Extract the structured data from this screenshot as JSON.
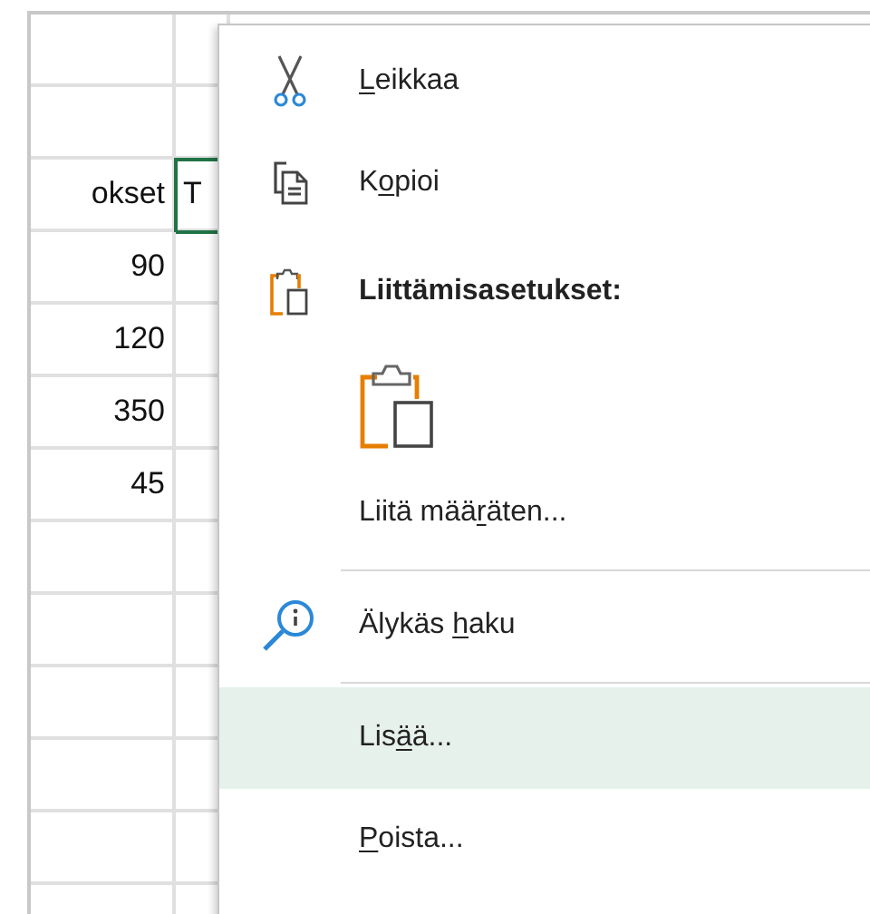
{
  "sheet": {
    "rows": [
      {
        "cells": [
          {
            "selected": false
          },
          {
            "selected": false
          }
        ]
      },
      {
        "cells": [
          {
            "selected": false
          },
          {
            "selected": false
          }
        ]
      },
      {
        "cells": [
          {
            "text": "okset",
            "selected": false
          },
          {
            "text": "T",
            "selected": true
          }
        ]
      },
      {
        "cells": [
          {
            "text": "90",
            "selected": false
          },
          {
            "selected": false
          }
        ]
      },
      {
        "cells": [
          {
            "text": "120",
            "selected": false
          },
          {
            "selected": false
          }
        ]
      },
      {
        "cells": [
          {
            "text": "350",
            "selected": false
          },
          {
            "selected": false
          }
        ]
      },
      {
        "cells": [
          {
            "text": "45",
            "selected": false
          },
          {
            "selected": false
          }
        ]
      },
      {
        "cells": [
          {
            "selected": false
          },
          {
            "selected": false
          }
        ]
      },
      {
        "cells": [
          {
            "selected": false
          },
          {
            "selected": false
          }
        ]
      },
      {
        "cells": [
          {
            "selected": false
          },
          {
            "selected": false
          }
        ]
      },
      {
        "cells": [
          {
            "selected": false
          },
          {
            "selected": false
          }
        ]
      },
      {
        "cells": [
          {
            "selected": false
          },
          {
            "selected": false
          }
        ]
      },
      {
        "cells": [
          {
            "selected": false
          },
          {
            "selected": false
          }
        ]
      }
    ]
  },
  "context_menu": {
    "items": [
      {
        "kind": "item",
        "label": {
          "key": "L",
          "after": "eikkaa"
        },
        "selected": false
      },
      {
        "kind": "item",
        "label": {
          "before": "K",
          "key": "o",
          "after": "pioi"
        },
        "selected": false
      },
      {
        "kind": "header",
        "label": {
          "before": "Liittämisasetukset:"
        },
        "selected": false
      },
      {
        "kind": "paste-option",
        "selected": false
      },
      {
        "kind": "item",
        "label": {
          "before": "Liitä mää",
          "key": "r",
          "after": "äten..."
        },
        "selected": false
      },
      {
        "kind": "separator"
      },
      {
        "kind": "item",
        "label": {
          "before": "Älykäs ",
          "key": "h",
          "after": "aku"
        },
        "selected": false
      },
      {
        "kind": "separator"
      },
      {
        "kind": "item",
        "label": {
          "before": "Lis",
          "key": "ä",
          "after": "ä..."
        },
        "selected": true
      },
      {
        "kind": "item",
        "label": {
          "key": "P",
          "after": "oista..."
        },
        "selected": false
      }
    ]
  }
}
